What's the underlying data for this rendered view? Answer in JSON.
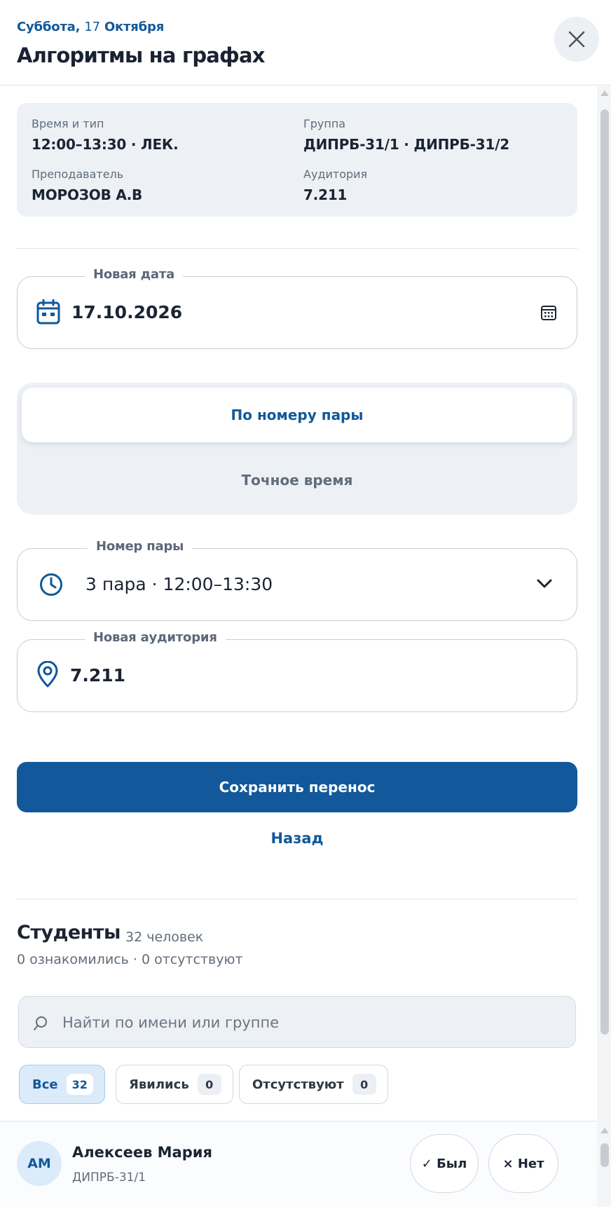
{
  "header": {
    "date_weekday": "Суббота,",
    "date_day": "17",
    "date_month": "Октября",
    "title": "Алгоритмы на графах",
    "close_icon": "close-icon"
  },
  "info": {
    "time_label": "Время и тип",
    "time_value": "12:00–13:30 · ЛЕК.",
    "group_label": "Группа",
    "group_value": "ДИПРБ-31/1 · ДИПРБ-31/2",
    "teacher_label": "Преподаватель",
    "teacher_value": "МОРОЗОВ А.В",
    "room_label": "Аудитория",
    "room_value": "7.211"
  },
  "form": {
    "date_label": "Новая дата",
    "date_value": "17.10.2026",
    "mode_options": [
      "По номеру пары",
      "Точное время"
    ],
    "mode_selected": "По номеру пары",
    "pair_label": "Номер пары",
    "pair_value": "3 пара · 12:00–13:30",
    "room_label": "Новая аудитория",
    "room_value": "7.211",
    "save_label": "Сохранить перенос",
    "back_label": "Назад"
  },
  "students": {
    "title": "Студенты",
    "count": "32 человек",
    "stats": "0 ознакомились · 0 отсутствуют",
    "search_placeholder": "Найти по имени или группе",
    "filters": [
      {
        "label": "Все",
        "count": "32"
      },
      {
        "label": "Явились",
        "count": "0"
      },
      {
        "label": "Отсутствуют",
        "count": "0"
      }
    ],
    "rows": [
      {
        "initials": "АМ",
        "name": "Алексеев Мария",
        "group": "ДИПРБ-31/1",
        "present_label": "✓ Был",
        "absent_label": "× Нет"
      }
    ]
  },
  "colors": {
    "accent": "#12589a",
    "surface": "#edf1f6",
    "text": "#1c2433",
    "muted": "#616c7b"
  }
}
